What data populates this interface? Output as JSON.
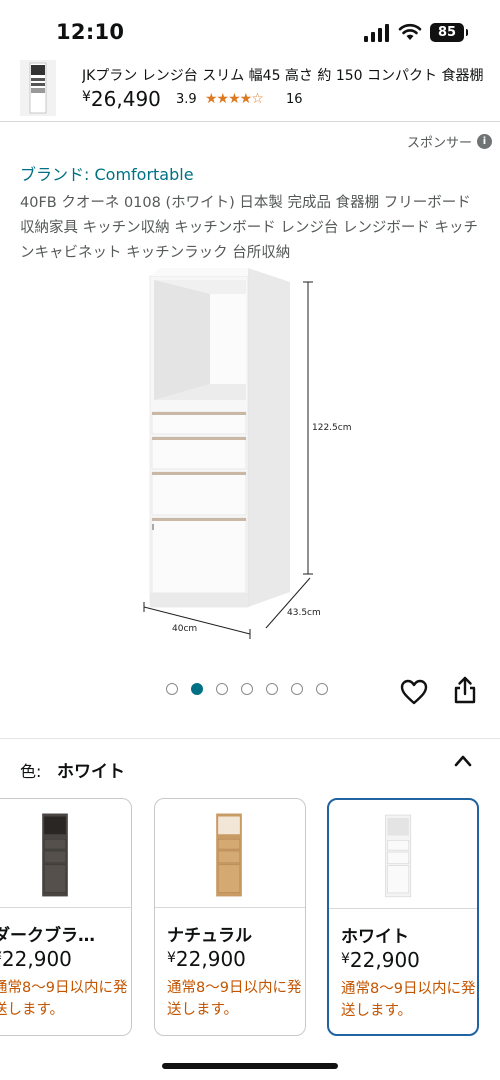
{
  "status_bar": {
    "time": "12:10",
    "battery": "85"
  },
  "sticky_header": {
    "title": "JKプラン レンジ台 スリム 幅45 高さ 約 150 コンパクト 食器棚",
    "price_symbol": "¥",
    "price": "26,490",
    "rating": "3.9",
    "stars": "★★★★☆",
    "review_count": "16"
  },
  "ad": {
    "sponsor_label": "スポンサー"
  },
  "brand": {
    "link_text": "ブランド: Comfortable"
  },
  "product": {
    "title": "40FB クオーネ 0108 (ホワイト) 日本製 完成品 食器棚 フリーボード 収納家具 キッチン収納 キッチンボード レンジ台 レンジボード キッチンキャビネット キッチンラック 台所収納",
    "dimensions": {
      "height": "122.5cm",
      "width": "40cm",
      "depth": "43.5cm"
    }
  },
  "gallery": {
    "total_images": 7,
    "active_index": 1
  },
  "color_selector": {
    "label": "色:",
    "selected": "ホワイト",
    "options": [
      {
        "name": "ダークブラ…",
        "price_symbol": "¥",
        "price": "22,900",
        "shipping": "通常8～9日以内に発送します。",
        "swatch": "#4a4541"
      },
      {
        "name": "ナチュラル",
        "price_symbol": "¥",
        "price": "22,900",
        "shipping": "通常8～9日以内に発送します。",
        "swatch": "#c89a64"
      },
      {
        "name": "ホワイト",
        "price_symbol": "¥",
        "price": "22,900",
        "shipping": "通常8～9日以内に発送します。",
        "swatch": "#f4f4f4"
      }
    ]
  },
  "colors": {
    "link": "#007185",
    "shipping": "#c45500",
    "selected_border": "#2162a1",
    "star": "#de7921"
  }
}
